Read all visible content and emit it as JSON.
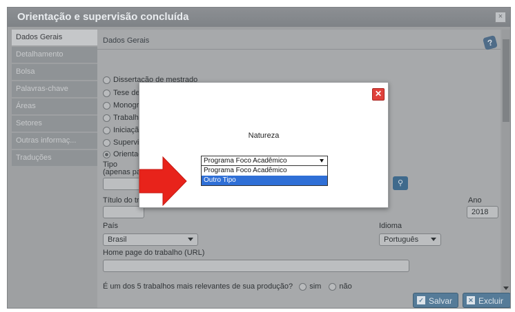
{
  "window": {
    "title": "Orientação e supervisão concluída",
    "close_glyph": "×"
  },
  "sidebar": {
    "items": [
      {
        "label": "Dados Gerais"
      },
      {
        "label": "Detalhamento"
      },
      {
        "label": "Bolsa"
      },
      {
        "label": "Palavras-chave"
      },
      {
        "label": "Áreas"
      },
      {
        "label": "Setores"
      },
      {
        "label": "Outras informaç..."
      },
      {
        "label": "Traduções"
      }
    ]
  },
  "content": {
    "header": "Dados Gerais",
    "natureza_options": [
      {
        "label": "Dissertação de mestrado",
        "checked": false
      },
      {
        "label": "Tese de",
        "checked": false
      },
      {
        "label": "Monogra",
        "checked": false
      },
      {
        "label": "Trabalho",
        "checked": false
      },
      {
        "label": "Iniciação",
        "checked": false
      },
      {
        "label": "Supervis",
        "checked": false
      },
      {
        "label": "Orientaç",
        "checked": true
      }
    ],
    "tipo_label": "Tipo",
    "tipo_sub": "(apenas para",
    "titulo_label": "Título do trab",
    "ano_label": "Ano",
    "ano_value": "2018",
    "pais_label": "País",
    "pais_value": "Brasil",
    "idioma_label": "Idioma",
    "idioma_value": "Português",
    "homepage_label": "Home page do trabalho (URL)",
    "relevante_question": "É um dos 5 trabalhos mais relevantes de sua produção?",
    "sim_label": "sim",
    "nao_label": "não"
  },
  "buttons": {
    "save": "Salvar",
    "delete": "Excluir"
  },
  "modal": {
    "label": "Natureza",
    "selected": "Programa Foco Acadêmico",
    "options": [
      "Programa Foco Acadêmico",
      "Outro Tipo"
    ],
    "highlighted_index": 1
  },
  "colors": {
    "modal_close": "#e0413b",
    "highlight": "#2f6fd6",
    "arrow": "#e8231b",
    "button": "#557b98"
  },
  "icons": {
    "help": "help-book-icon",
    "search": "search-icon",
    "arrow": "red-arrow-annotation"
  }
}
